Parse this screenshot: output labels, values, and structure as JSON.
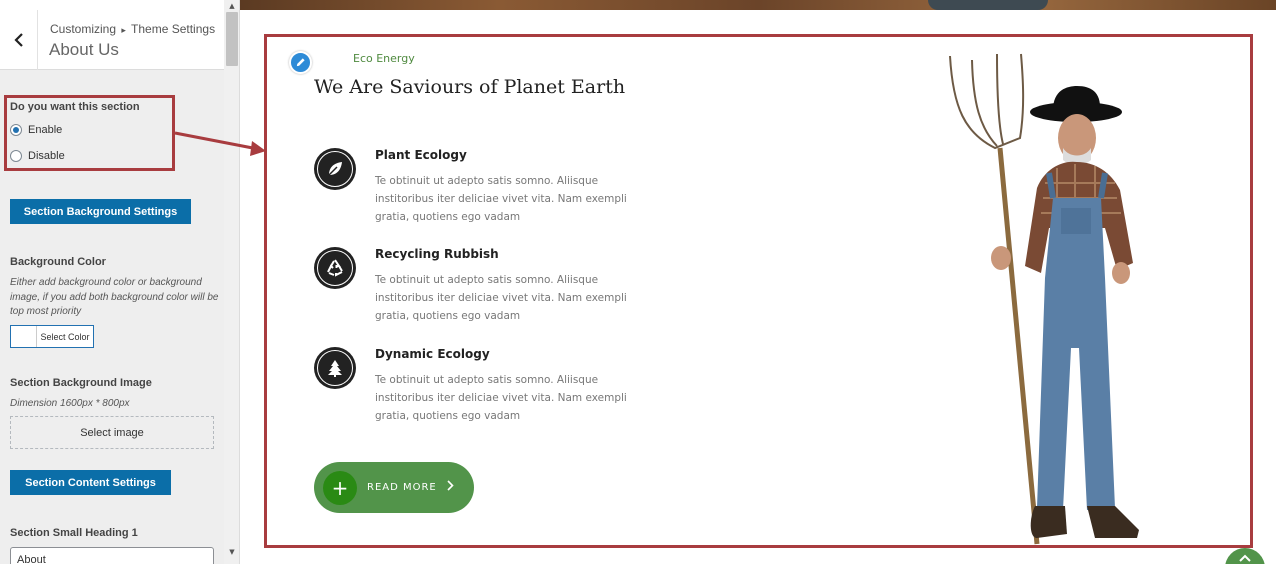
{
  "sidebar": {
    "back_icon": "chevron-left-icon",
    "breadcrumb_customizing": "Customizing",
    "breadcrumb_separator": "▸",
    "breadcrumb_theme_settings": "Theme Settings",
    "section_title": "About Us",
    "enable_section_label": "Do you want this section",
    "enable_option": "Enable",
    "disable_option": "Disable",
    "selected_option": "Enable",
    "bg_settings_button": "Section Background Settings",
    "bg_color_label": "Background Color",
    "bg_color_description": "Either add background color or background image, if you add both background color will be top most priority",
    "select_color_button": "Select Color",
    "bg_image_label": "Section Background Image",
    "bg_image_dimension": "Dimension 1600px * 800px",
    "select_image_button": "Select image",
    "content_settings_button": "Section Content Settings",
    "small_heading_label": "Section Small Heading 1",
    "small_heading_value": "About"
  },
  "preview": {
    "edit_icon": "pencil-icon",
    "small_heading": "Eco Energy",
    "heading": "We Are Saviours of Planet Earth",
    "features": [
      {
        "icon": "leaf-icon",
        "title": "Plant Ecology",
        "description": "Te obtinuit ut adepto satis somno. Aliisque institoribus iter deliciae vivet vita. Nam exempli gratia, quotiens ego vadam"
      },
      {
        "icon": "recycle-icon",
        "title": "Recycling Rubbish",
        "description": "Te obtinuit ut adepto satis somno. Aliisque institoribus iter deliciae vivet vita. Nam exempli gratia, quotiens ego vadam"
      },
      {
        "icon": "tree-icon",
        "title": "Dynamic Ecology",
        "description": "Te obtinuit ut adepto satis somno. Aliisque institoribus iter deliciae vivet vita. Nam exempli gratia, quotiens ego vadam"
      }
    ],
    "read_more_label": "READ MORE",
    "read_more_icon": "plus-icon",
    "read_more_chevron": "chevron-right-icon",
    "scroll_top_icon": "chevron-up-icon"
  },
  "colors": {
    "annotation": "#a83c3f",
    "primary_button": "#0b6ea8",
    "accent_green": "#52944a",
    "dark_green": "#2a8a14",
    "heading_green": "#4f8a3f",
    "edit_blue": "#2e8bd7"
  }
}
